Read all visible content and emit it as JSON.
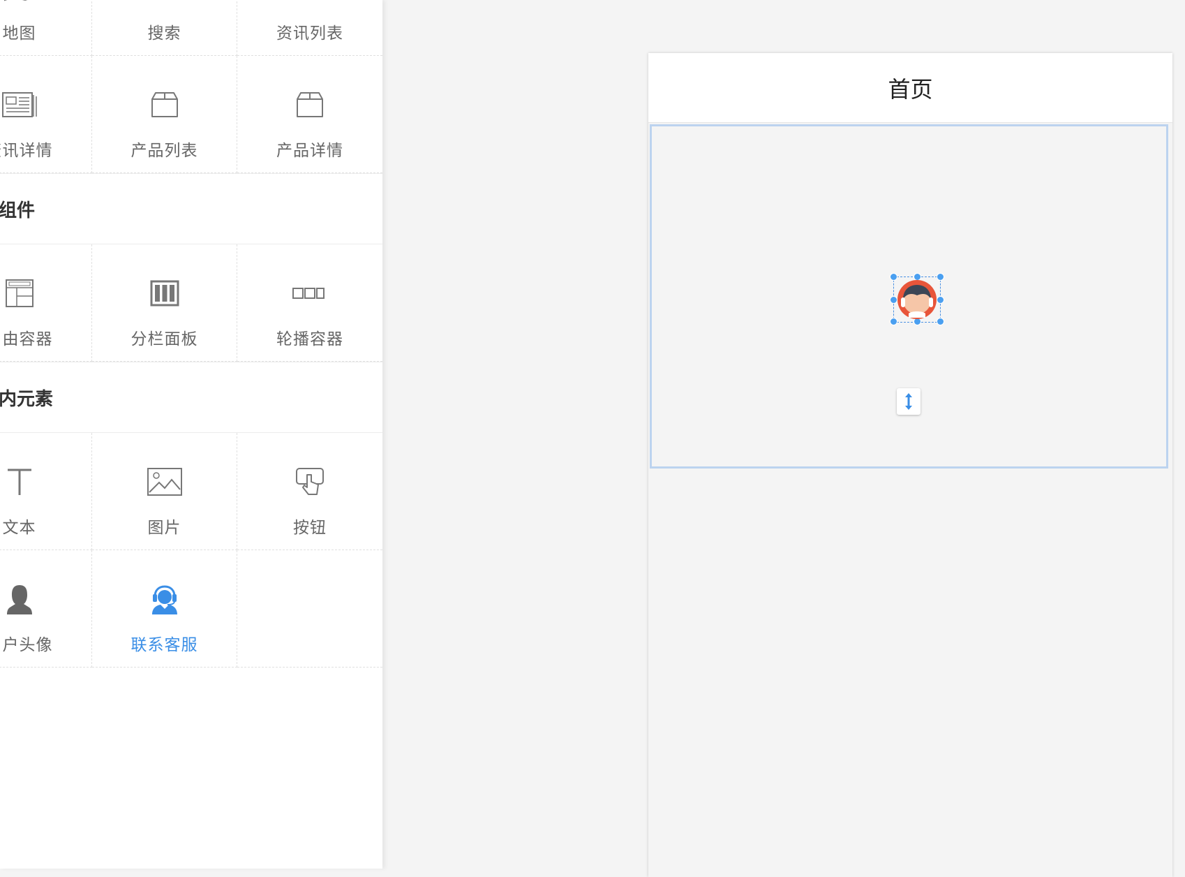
{
  "panel": {
    "row1": [
      {
        "label": "地图",
        "icon": "map-icon"
      },
      {
        "label": "搜索",
        "icon": "search-icon"
      },
      {
        "label": "资讯列表",
        "icon": "news-list-icon"
      }
    ],
    "row2": [
      {
        "label": "资讯详情",
        "icon": "news-detail-icon"
      },
      {
        "label": "产品列表",
        "icon": "product-list-icon"
      },
      {
        "label": "产品详情",
        "icon": "product-detail-icon"
      }
    ],
    "section_container": "容器组件",
    "row3": [
      {
        "label": "自由容器",
        "icon": "free-container-icon"
      },
      {
        "label": "分栏面板",
        "icon": "column-panel-icon"
      },
      {
        "label": "轮播容器",
        "icon": "carousel-icon"
      }
    ],
    "section_elements": "容器内元素",
    "row4": [
      {
        "label": "文本",
        "icon": "text-icon"
      },
      {
        "label": "图片",
        "icon": "image-icon"
      },
      {
        "label": "按钮",
        "icon": "button-icon"
      }
    ],
    "row5": [
      {
        "label": "用户头像",
        "icon": "user-avatar-icon"
      },
      {
        "label": "联系客服",
        "icon": "customer-service-icon",
        "active": true
      }
    ]
  },
  "phone": {
    "title": "首页"
  },
  "colors": {
    "accent": "#3a8ee6",
    "icon_gray": "#777777",
    "service_orange": "#e8553a"
  }
}
